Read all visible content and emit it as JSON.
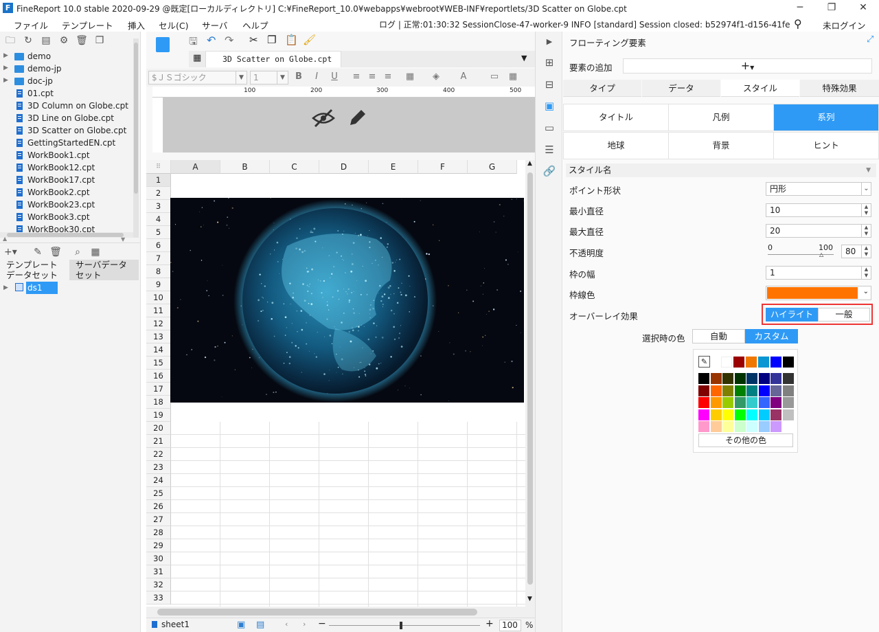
{
  "window": {
    "title": "FineReport 10.0 stable 2020-09-29 @既定[ローカルディレクトリ]   C:¥FineReport_10.0¥webapps¥webroot¥WEB-INF¥reportlets/3D Scatter on Globe.cpt",
    "logo_letter": "F"
  },
  "menu": {
    "items": [
      "ファイル",
      "テンプレート",
      "挿入",
      "セル(C)",
      "サーバ",
      "ヘルプ"
    ],
    "log_text": "ログ | 正常:01:30:32 SessionClose-47-worker-9 INFO [standard] Session closed: b52974f1-d156-41fe-820f-...",
    "login": "未ログイン"
  },
  "file_tree": [
    {
      "name": "demo",
      "type": "folder"
    },
    {
      "name": "demo-jp",
      "type": "folder"
    },
    {
      "name": "doc-jp",
      "type": "folder"
    },
    {
      "name": "01.cpt",
      "type": "file"
    },
    {
      "name": "3D Column on Globe.cpt",
      "type": "file"
    },
    {
      "name": "3D Line on Globe.cpt",
      "type": "file"
    },
    {
      "name": "3D Scatter on Globe.cpt",
      "type": "file"
    },
    {
      "name": "GettingStartedEN.cpt",
      "type": "file"
    },
    {
      "name": "WorkBook1.cpt",
      "type": "file"
    },
    {
      "name": "WorkBook12.cpt",
      "type": "file"
    },
    {
      "name": "WorkBook17.cpt",
      "type": "file"
    },
    {
      "name": "WorkBook2.cpt",
      "type": "file"
    },
    {
      "name": "WorkBook23.cpt",
      "type": "file"
    },
    {
      "name": "WorkBook3.cpt",
      "type": "file"
    },
    {
      "name": "WorkBook30.cpt",
      "type": "file"
    }
  ],
  "dataset": {
    "tab_template": "テンプレート\nデータセット",
    "tab_template_l1": "テンプレート",
    "tab_template_l2": "データセット",
    "tab_server_l1": "サーバデータ",
    "tab_server_l2": "セット",
    "ds1": "ds1"
  },
  "editor": {
    "doc_tab": "3D Scatter on Globe.cpt",
    "font_name": "$ＪＳゴシック",
    "font_size": "1",
    "ruler_ticks": [
      "100",
      "200",
      "300",
      "400",
      "500"
    ],
    "columns": [
      "A",
      "B",
      "C",
      "D",
      "E",
      "F",
      "G"
    ],
    "rows": [
      "1",
      "2",
      "3",
      "4",
      "5",
      "6",
      "7",
      "8",
      "9",
      "10",
      "11",
      "12",
      "13",
      "14",
      "15",
      "16",
      "17",
      "18",
      "19",
      "20",
      "21",
      "22",
      "23",
      "24",
      "25",
      "26",
      "27",
      "28",
      "29",
      "30",
      "31",
      "32",
      "33"
    ],
    "sheet": "sheet1",
    "zoom": "100",
    "zoom_unit": "%"
  },
  "panel": {
    "title": "フローティング要素",
    "add_element_label": "要素の追加",
    "tabs": [
      "タイプ",
      "データ",
      "スタイル",
      "特殊効果"
    ],
    "active_tab": "スタイル",
    "categories": [
      "タイトル",
      "凡例",
      "系列",
      "地球",
      "背景",
      "ヒント"
    ],
    "active_category": "系列",
    "section": "スタイル名",
    "props": {
      "point_shape_label": "ポイント形状",
      "point_shape_value": "円形",
      "min_diameter_label": "最小直径",
      "min_diameter_value": "10",
      "max_diameter_label": "最大直径",
      "max_diameter_value": "20",
      "opacity_label": "不透明度",
      "opacity_min": "0",
      "opacity_max": "100",
      "opacity_value": "80",
      "border_width_label": "枠の幅",
      "border_width_value": "1",
      "border_color_label": "枠線色",
      "border_color": "#ff7300",
      "overlay_label": "オーバーレイ効果",
      "overlay_highlight": "ハイライト",
      "overlay_normal": "一般",
      "selection_color_label": "選択時の色",
      "auto": "自動",
      "custom": "カスタム",
      "more_colors": "その他の色"
    },
    "accent": "#2e9af5"
  },
  "palette": {
    "top": [
      "#ffffff",
      "#9b0000",
      "#f07800",
      "#0a96d2",
      "#0000ff",
      "#000000"
    ],
    "grid": [
      [
        "#000000",
        "#993300",
        "#333300",
        "#003300",
        "#003366",
        "#000080",
        "#333399",
        "#333333"
      ],
      [
        "#800000",
        "#ff6600",
        "#808000",
        "#008000",
        "#008080",
        "#0000ff",
        "#666699",
        "#808080"
      ],
      [
        "#ff0000",
        "#ff9900",
        "#99cc00",
        "#339966",
        "#33cccc",
        "#3366ff",
        "#800080",
        "#999999"
      ],
      [
        "#ff00ff",
        "#ffcc00",
        "#ffff00",
        "#00ff00",
        "#00ffff",
        "#00ccff",
        "#993366",
        "#c0c0c0"
      ],
      [
        "#ff99cc",
        "#ffcc99",
        "#ffff99",
        "#ccffcc",
        "#ccffff",
        "#99ccff",
        "#cc99ff",
        "#ffffff"
      ]
    ]
  }
}
